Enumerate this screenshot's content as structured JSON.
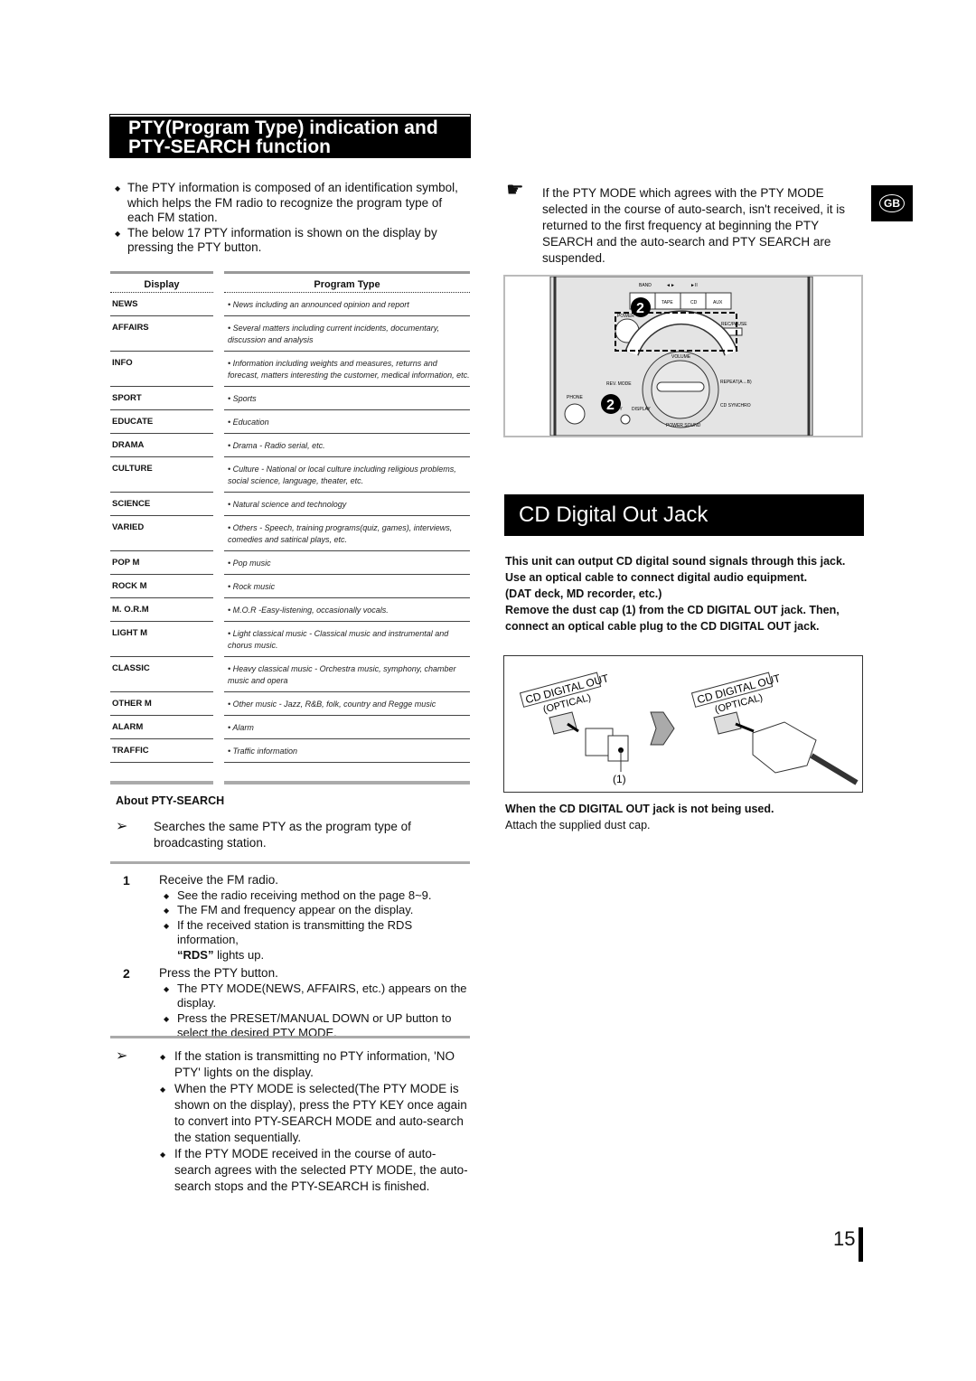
{
  "left": {
    "title_line1": "PTY(Program Type) indication and",
    "title_line2": "PTY-SEARCH function",
    "intro": [
      "The PTY information is composed of an identification symbol, which helps the FM radio to recognize the program type of each FM station.",
      "The below 17 PTY information is shown on the display by pressing the PTY button."
    ],
    "table": {
      "headers": [
        "Display",
        "Program Type"
      ],
      "rows": [
        [
          "NEWS",
          "• News including an announced opinion and report"
        ],
        [
          "AFFAIRS",
          "• Several matters including current incidents, documentary, discussion and analysis"
        ],
        [
          "INFO",
          "• Information including weights and measures, returns and forecast, matters interesting the customer, medical information, etc."
        ],
        [
          "SPORT",
          "• Sports"
        ],
        [
          "EDUCATE",
          "• Education"
        ],
        [
          "DRAMA",
          "• Drama - Radio serial, etc."
        ],
        [
          "CULTURE",
          "• Culture - National or local culture including religious problems, social science, language, theater, etc."
        ],
        [
          "SCIENCE",
          "• Natural science and technology"
        ],
        [
          "VARIED",
          "• Others - Speech, training programs(quiz, games), interviews, comedies and satirical plays, etc."
        ],
        [
          "POP M",
          "• Pop music"
        ],
        [
          "ROCK M",
          "• Rock music"
        ],
        [
          "M. O.R.M",
          "• M.O.R -Easy-listening, occasionally vocals."
        ],
        [
          "LIGHT M",
          "• Light classical music - Classical music and instrumental and chorus music."
        ],
        [
          "CLASSIC",
          "• Heavy classical music - Orchestra music, symphony, chamber music and opera"
        ],
        [
          "OTHER M",
          "• Other music - Jazz, R&B, folk, country and Regge music"
        ],
        [
          "ALARM",
          "• Alarm"
        ],
        [
          "TRAFFIC",
          "• Traffic information"
        ]
      ]
    },
    "about_title": "About PTY-SEARCH",
    "about_text": "Searches the same PTY as the program type of broadcasting station.",
    "steps": [
      {
        "num": "1",
        "text": "Receive the FM radio.",
        "subs": [
          "See the radio receiving method on the page 8~9.",
          "The FM and frequency appear on the display."
        ],
        "rds_pre": "If the received station is transmitting the RDS information,",
        "rds_bold": "“RDS”",
        "rds_post": " lights up."
      },
      {
        "num": "2",
        "text": "Press the PTY button.",
        "subs": [
          "The PTY MODE(NEWS, AFFAIRS, etc.) appears on the display.",
          "Press the PRESET/MANUAL DOWN or UP button to select the desired PTY MODE."
        ]
      }
    ],
    "notes": [
      "If the station is transmitting no PTY information, 'NO PTY' lights on the display.",
      "When the PTY MODE is selected(The PTY MODE is shown on the display), press the PTY KEY once again to convert into PTY-SEARCH MODE and auto-search the station sequentially.",
      "If the PTY MODE received in the course of auto-search agrees with the selected PTY MODE, the auto-search stops and the PTY-SEARCH is finished."
    ]
  },
  "right": {
    "note": "If the PTY MODE which agrees with the PTY MODE selected in the course of auto-search, isn't received, it is returned to the first frequency at beginning the PTY SEARCH and the auto-search and PTY SEARCH are suspended.",
    "lang_badge": "GB",
    "panel": {
      "labels": [
        "BAND",
        "◄►",
        "►II",
        "TAPE",
        "CD",
        "AUX",
        "POWER",
        "REV. MODE",
        "PHONE",
        "PTY",
        "DISPLAY",
        "VOLUME",
        "REPEAT(A↔B)",
        "CD SYNCHRO",
        "POWER SOUND",
        "REC/PAUSE"
      ],
      "callout": "2"
    },
    "title": "CD Digital Out Jack",
    "body": [
      "This unit can output CD digital sound signals through this jack.",
      "Use an optical cable to connect digital audio equipment.",
      "(DAT deck, MD recorder, etc.)",
      "Remove the dust cap (1) from the CD DIGITAL OUT jack. Then, connect an optical cable plug to the CD DIGITAL OUT jack."
    ],
    "jack_label": "CD DIGITAL OUT",
    "jack_sub": "(OPTICAL)",
    "cap_label": "(1)",
    "when_title": "When the CD DIGITAL OUT jack is not being used.",
    "when_text": "Attach the supplied dust cap."
  },
  "page_number": "15"
}
